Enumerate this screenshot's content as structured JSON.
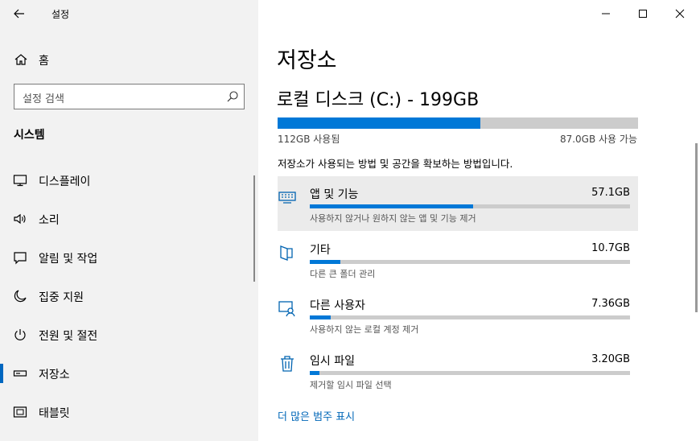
{
  "app": {
    "title": "설정"
  },
  "sidebar": {
    "home_label": "홈",
    "search_placeholder": "설정 검색",
    "section_title": "시스템",
    "items": [
      {
        "label": "디스플레이",
        "icon": "monitor-icon"
      },
      {
        "label": "소리",
        "icon": "speaker-icon"
      },
      {
        "label": "알림 및 작업",
        "icon": "notification-icon"
      },
      {
        "label": "집중 지원",
        "icon": "moon-icon"
      },
      {
        "label": "전원 및 절전",
        "icon": "power-icon"
      },
      {
        "label": "저장소",
        "icon": "storage-icon",
        "selected": true
      },
      {
        "label": "태블릿",
        "icon": "tablet-icon"
      }
    ]
  },
  "main": {
    "title": "저장소",
    "disk": {
      "name": "로컬 디스크 (C:) - 199GB",
      "used_label": "112GB 사용됨",
      "free_label": "87.0GB 사용 가능",
      "used_fraction": 0.563
    },
    "description": "저장소가 사용되는 방법 및 공간을 확보하는 방법입니다.",
    "categories": [
      {
        "name": "앱 및 기능",
        "size": "57.1GB",
        "sub": "사용하지 않거나 원하지 않는 앱 및 기능 제거",
        "fraction": 0.51,
        "icon": "apps-icon"
      },
      {
        "name": "기타",
        "size": "10.7GB",
        "sub": "다른 큰 폴더 관리",
        "fraction": 0.096,
        "icon": "folder-icon"
      },
      {
        "name": "다른 사용자",
        "size": "7.36GB",
        "sub": "사용하지 않는 로컬 계정 제거",
        "fraction": 0.066,
        "icon": "user-icon"
      },
      {
        "name": "임시 파일",
        "size": "3.20GB",
        "sub": "제거할 임시 파일 선택",
        "fraction": 0.029,
        "icon": "trash-icon"
      }
    ],
    "more_link": "더 많은 범주 표시"
  },
  "colors": {
    "accent": "#0078d7",
    "link": "#0067b8",
    "sidebar_bg": "#f2f2f2",
    "track": "#cccccc"
  }
}
